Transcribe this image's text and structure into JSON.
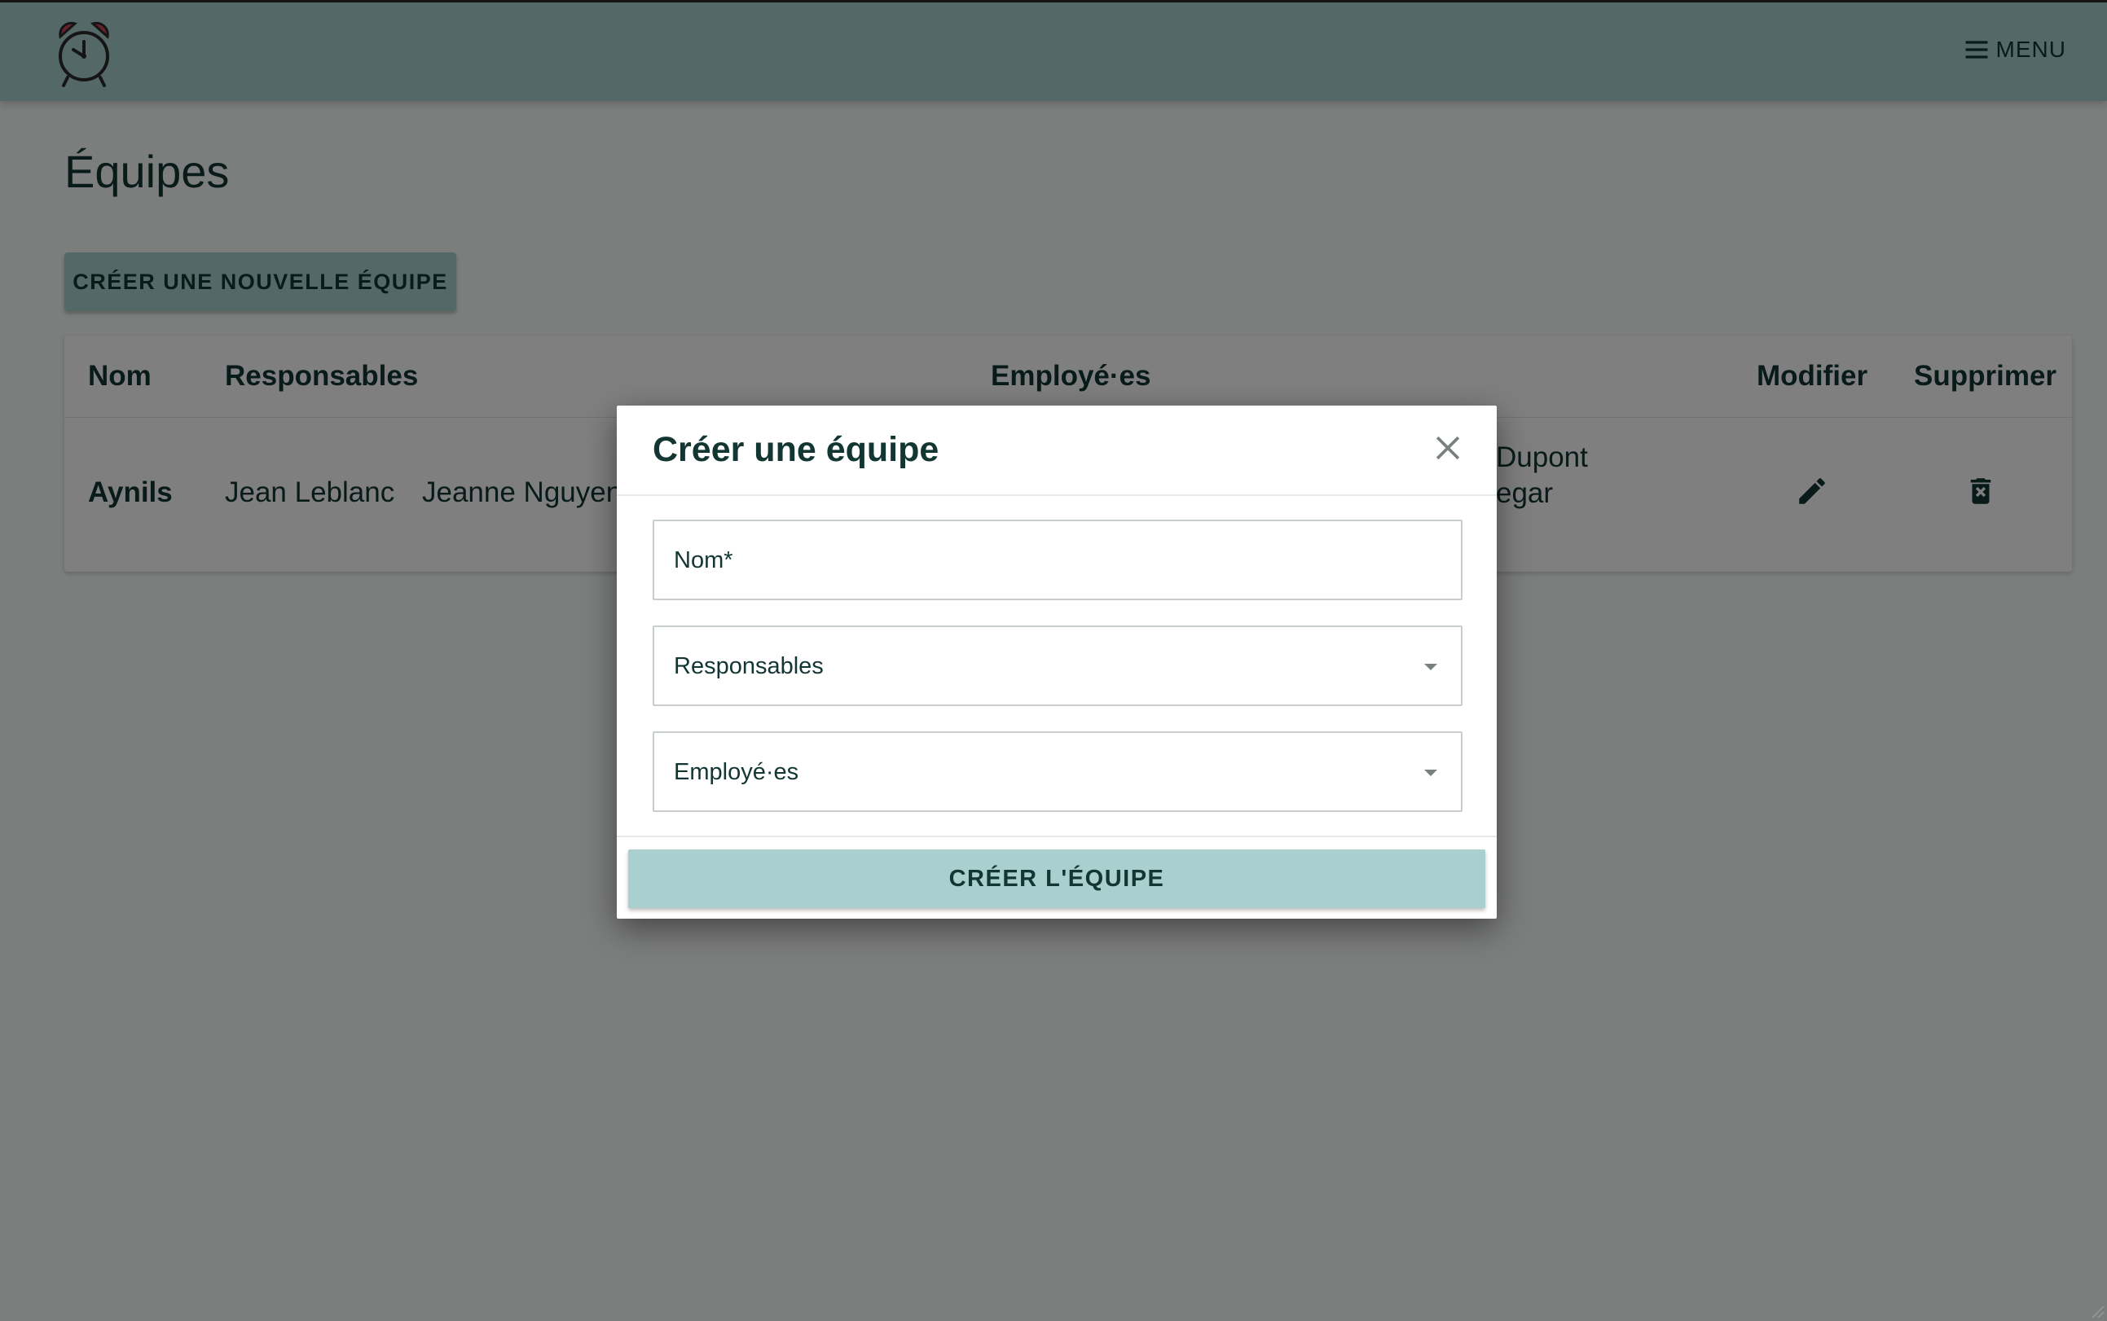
{
  "header": {
    "logo_icon": "alarm-clock-icon",
    "menu_icon": "hamburger-icon",
    "menu_label": "MENU"
  },
  "page": {
    "title": "Équipes",
    "new_team_button": "CRÉER UNE NOUVELLE ÉQUIPE"
  },
  "table": {
    "columns": [
      "Nom",
      "Responsables",
      "Employé·es",
      "Modifier",
      "Supprimer"
    ],
    "rows": [
      {
        "name": "Aynils",
        "managers": [
          "Jean Leblanc",
          "Jeanne Nguyen"
        ],
        "employees_line1": "Dupont",
        "employees_line2": "egar",
        "edit_icon": "pencil-icon",
        "delete_icon": "trash-icon"
      }
    ]
  },
  "dialog": {
    "title": "Créer une équipe",
    "close_icon": "close-icon",
    "name_label": "Nom*",
    "name_value": "",
    "managers_label": "Responsables",
    "employees_label": "Employé·es",
    "dropdown_icon": "caret-down-icon",
    "submit_label": "CRÉER L'ÉQUIPE"
  },
  "colors": {
    "accent": "#a9d0cf",
    "text": "#123632",
    "logo": "#c0392b",
    "overlay": "rgba(0,0,0,0.5)"
  }
}
